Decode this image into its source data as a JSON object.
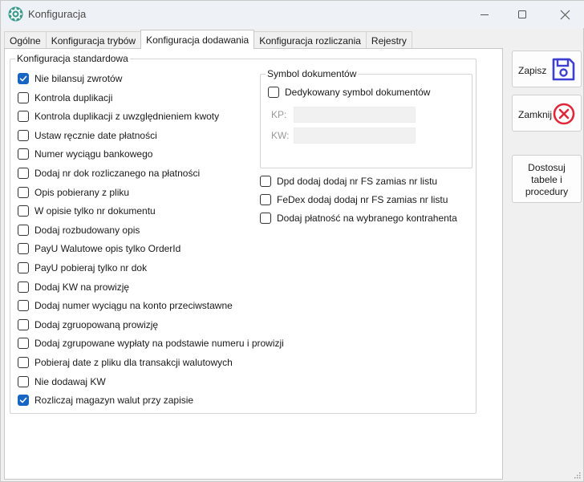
{
  "window": {
    "title": "Konfiguracja"
  },
  "tabs": [
    {
      "label": "Ogólne"
    },
    {
      "label": "Konfiguracja trybów"
    },
    {
      "label": "Konfiguracja dodawania"
    },
    {
      "label": "Konfiguracja rozliczania"
    },
    {
      "label": "Rejestry"
    }
  ],
  "standard_group": {
    "label": "Konfiguracja standardowa",
    "options": [
      {
        "label": "Nie bilansuj zwrotów",
        "checked": true
      },
      {
        "label": "Kontrola duplikacji",
        "checked": false
      },
      {
        "label": "Kontrola duplikacji z uwzględnieniem kwoty",
        "checked": false
      },
      {
        "label": "Ustaw ręcznie date płatności",
        "checked": false
      },
      {
        "label": "Numer wyciągu bankowego",
        "checked": false
      },
      {
        "label": "Dodaj nr dok rozliczanego na płatności",
        "checked": false
      },
      {
        "label": "Opis pobierany z pliku",
        "checked": false
      },
      {
        "label": "W opisie tylko nr dokumentu",
        "checked": false
      },
      {
        "label": "Dodaj rozbudowany opis",
        "checked": false
      },
      {
        "label": "PayU Walutowe opis tylko OrderId",
        "checked": false
      },
      {
        "label": "PayU pobieraj tylko nr dok",
        "checked": false
      },
      {
        "label": "Dodaj KW na prowizję",
        "checked": false
      },
      {
        "label": "Dodaj numer wyciągu na konto przeciwstawne",
        "checked": false
      },
      {
        "label": "Dodaj zgruopowaną prowizję",
        "checked": false
      },
      {
        "label": "Dodaj zgrupowane wypłaty na podstawie numeru i prowizji",
        "checked": false
      },
      {
        "label": "Pobieraj date z pliku dla transakcji walutowych",
        "checked": false
      },
      {
        "label": "Nie dodawaj KW",
        "checked": false
      },
      {
        "label": "Rozliczaj magazyn walut przy zapisie",
        "checked": true
      }
    ]
  },
  "symbol_group": {
    "label": "Symbol dokumentów",
    "dedicated": {
      "label": "Dedykowany symbol dokumentów",
      "checked": false
    },
    "kp": {
      "label": "KP:",
      "value": ""
    },
    "kw": {
      "label": "KW:",
      "value": ""
    }
  },
  "extra_options": [
    {
      "label": "Dpd dodaj dodaj nr FS zamias nr listu",
      "checked": false
    },
    {
      "label": "FeDex dodaj dodaj nr FS zamias nr listu",
      "checked": false
    },
    {
      "label": "Dodaj płatność na wybranego kontrahenta",
      "checked": false
    }
  ],
  "buttons": {
    "save": "Zapisz",
    "close": "Zamknij",
    "customize": [
      "Dostosuj",
      "tabele i",
      "procedury"
    ]
  },
  "colors": {
    "accent": "#1766c4",
    "save_icon": "#3d3fd1",
    "close_icon": "#e0283a"
  }
}
